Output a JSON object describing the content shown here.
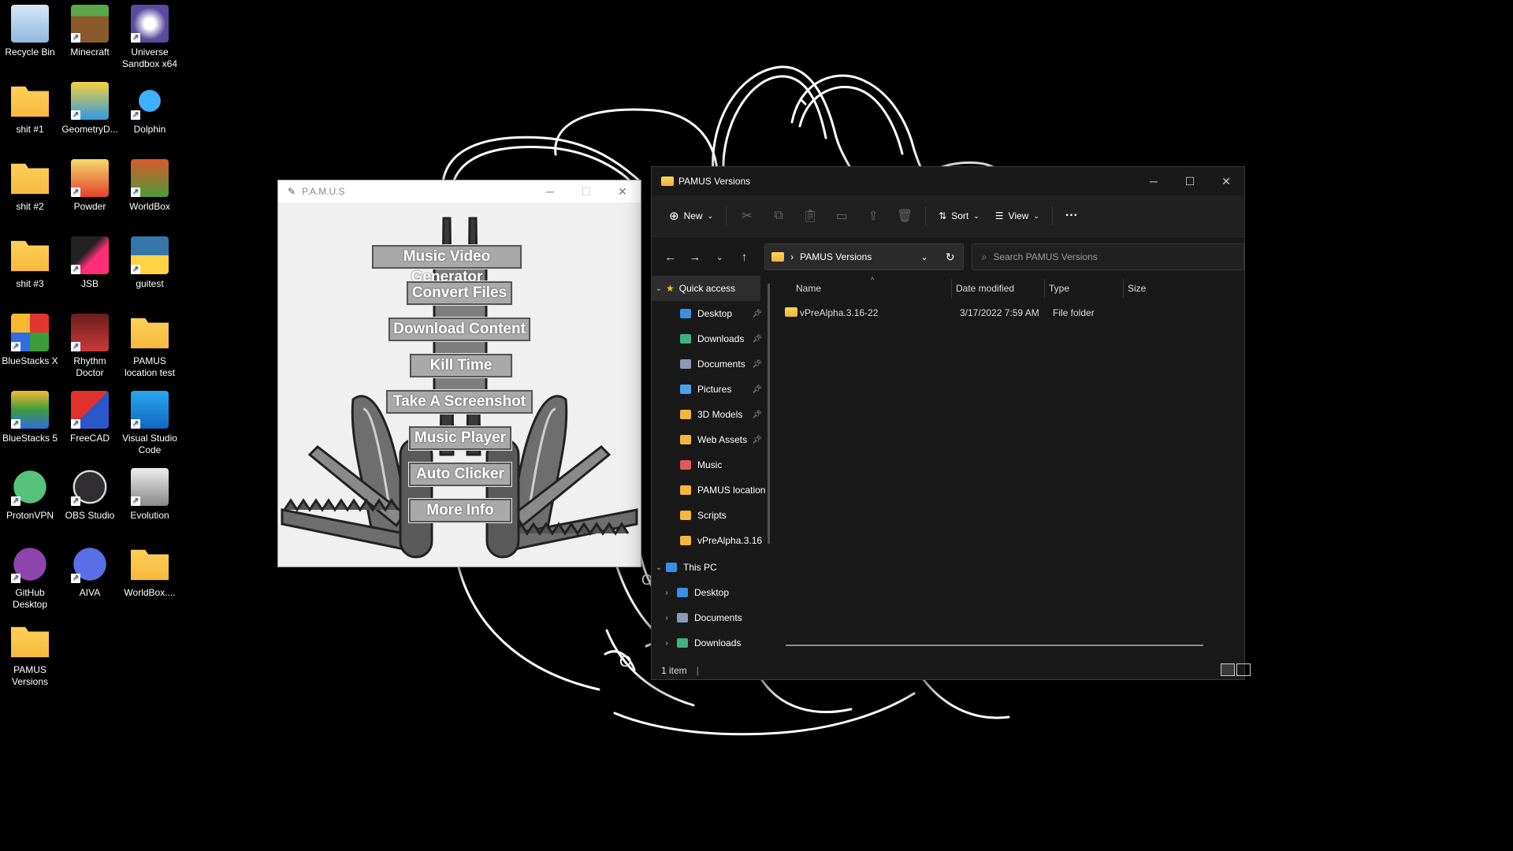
{
  "desktop": {
    "icons": [
      {
        "label": "Recycle Bin",
        "icon": "recycle-bin-icon"
      },
      {
        "label": "Minecraft",
        "icon": "minecraft-icon"
      },
      {
        "label": "Universe Sandbox x64",
        "icon": "universe-sandbox-icon"
      },
      {
        "label": "shit #1",
        "icon": "folder-icon"
      },
      {
        "label": "GeometryD...",
        "icon": "geometry-dash-icon"
      },
      {
        "label": "Dolphin",
        "icon": "dolphin-icon"
      },
      {
        "label": "shit #2",
        "icon": "folder-icon"
      },
      {
        "label": "Powder",
        "icon": "powder-icon"
      },
      {
        "label": "WorldBox",
        "icon": "worldbox-icon"
      },
      {
        "label": "shit #3",
        "icon": "folder-icon"
      },
      {
        "label": "JSB",
        "icon": "jsb-icon"
      },
      {
        "label": "guitest",
        "icon": "python-file-icon"
      },
      {
        "label": "BlueStacks X",
        "icon": "bluestacks-x-icon"
      },
      {
        "label": "Rhythm Doctor",
        "icon": "rhythm-doctor-icon"
      },
      {
        "label": "PAMUS location test",
        "icon": "folder-icon"
      },
      {
        "label": "BlueStacks 5",
        "icon": "bluestacks-5-icon"
      },
      {
        "label": "FreeCAD",
        "icon": "freecad-icon"
      },
      {
        "label": "Visual Studio Code",
        "icon": "vscode-icon"
      },
      {
        "label": "ProtonVPN",
        "icon": "protonvpn-icon"
      },
      {
        "label": "OBS Studio",
        "icon": "obs-icon"
      },
      {
        "label": "Evolution",
        "icon": "evolution-icon"
      },
      {
        "label": "GitHub Desktop",
        "icon": "github-icon"
      },
      {
        "label": "AIVA",
        "icon": "aiva-icon"
      },
      {
        "label": "WorldBox....",
        "icon": "folder-icon"
      },
      {
        "label": "PAMUS Versions",
        "icon": "folder-icon"
      }
    ]
  },
  "pamus": {
    "title": "P.A.M.U.S",
    "buttons": [
      "Music Video Generator",
      "Convert Files",
      "Download Content",
      "Kill Time",
      "Take A Screenshot",
      "Music Player",
      "Auto Clicker",
      "More Info"
    ]
  },
  "explorer": {
    "title": "PAMUS Versions",
    "toolbar": {
      "new_label": "New",
      "sort_label": "Sort",
      "view_label": "View",
      "more_label": "···"
    },
    "address": {
      "path": "PAMUS Versions",
      "search_placeholder": "Search PAMUS Versions"
    },
    "nav": {
      "quick_access": "Quick access",
      "quick_items": [
        {
          "label": "Desktop",
          "pinned": true,
          "color": "#3a8ee6"
        },
        {
          "label": "Downloads",
          "pinned": true,
          "color": "#3fb27f"
        },
        {
          "label": "Documents",
          "pinned": true,
          "color": "#8c9bb5"
        },
        {
          "label": "Pictures",
          "pinned": true,
          "color": "#4aa3e8"
        },
        {
          "label": "3D Models",
          "pinned": true,
          "color": "#f5b73b"
        },
        {
          "label": "Web Assets",
          "pinned": true,
          "color": "#f5b73b"
        },
        {
          "label": "Music",
          "pinned": false,
          "color": "#e05a5a"
        },
        {
          "label": "PAMUS location",
          "pinned": false,
          "color": "#f5b73b"
        },
        {
          "label": "Scripts",
          "pinned": false,
          "color": "#f5b73b"
        },
        {
          "label": "vPreAlpha.3.16",
          "pinned": false,
          "color": "#f5b73b"
        }
      ],
      "this_pc": "This PC",
      "pc_items": [
        {
          "label": "Desktop",
          "color": "#3a8ee6"
        },
        {
          "label": "Documents",
          "color": "#8c9bb5"
        },
        {
          "label": "Downloads",
          "color": "#3fb27f"
        }
      ]
    },
    "columns": {
      "name": "Name",
      "date": "Date modified",
      "type": "Type",
      "size": "Size"
    },
    "files": [
      {
        "name": "vPreAlpha.3.16-22",
        "date": "3/17/2022 7:59 AM",
        "type": "File folder",
        "size": ""
      }
    ],
    "status": "1 item"
  }
}
